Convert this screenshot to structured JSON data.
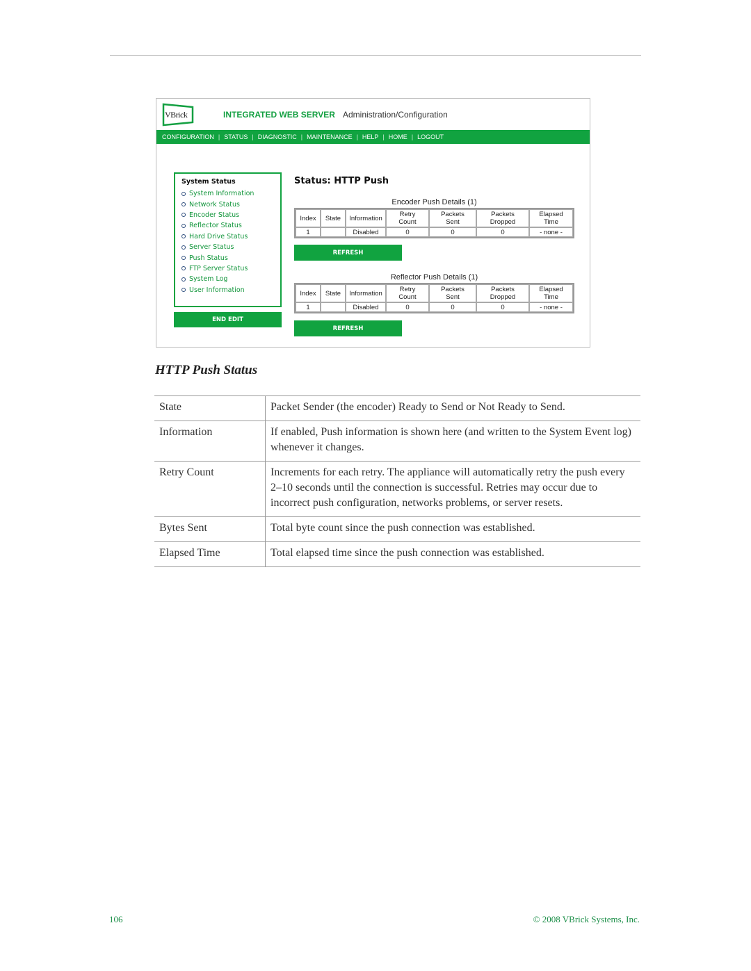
{
  "screenshot": {
    "logo_text": "VBrick",
    "header_title": "INTEGRATED WEB SERVER",
    "header_subtitle": "Administration/Configuration",
    "nav": [
      "CONFIGURATION",
      "STATUS",
      "DIAGNOSTIC",
      "MAINTENANCE",
      "HELP",
      "HOME",
      "LOGOUT"
    ],
    "sidebar": {
      "title": "System Status",
      "items": [
        "System Information",
        "Network Status",
        "Encoder Status",
        "Reflector Status",
        "Hard Drive Status",
        "Server Status",
        "Push Status",
        "FTP Server Status",
        "System Log",
        "User Information"
      ],
      "end_edit_label": "END EDIT"
    },
    "page_title": "Status: HTTP Push",
    "tables": [
      {
        "caption": "Encoder Push Details  (1)",
        "headers": [
          "Index",
          "State",
          "Information",
          "Retry Count",
          "Packets Sent",
          "Packets Dropped",
          "Elapsed Time"
        ],
        "headers_line1": [
          "Index",
          "State",
          "Information",
          "Retry",
          "Packets",
          "Packets",
          "Elapsed"
        ],
        "headers_line2": [
          "",
          "",
          "",
          "Count",
          "Sent",
          "Dropped",
          "Time"
        ],
        "rows": [
          [
            "1",
            "",
            "Disabled",
            "0",
            "0",
            "0",
            "- none -"
          ]
        ],
        "refresh_label": "REFRESH"
      },
      {
        "caption": "Reflector Push Details  (1)",
        "headers": [
          "Index",
          "State",
          "Information",
          "Retry Count",
          "Packets Sent",
          "Packets Dropped",
          "Elapsed Time"
        ],
        "headers_line1": [
          "Index",
          "State",
          "Information",
          "Retry",
          "Packets",
          "Packets",
          "Elapsed"
        ],
        "headers_line2": [
          "",
          "",
          "",
          "Count",
          "Sent",
          "Dropped",
          "Time"
        ],
        "rows": [
          [
            "1",
            "",
            "Disabled",
            "0",
            "0",
            "0",
            "- none -"
          ]
        ],
        "refresh_label": "REFRESH"
      }
    ]
  },
  "section_title": "HTTP Push Status",
  "definitions": [
    {
      "term": "State",
      "description": "Packet Sender (the encoder) Ready to Send or Not Ready to Send."
    },
    {
      "term": "Information",
      "description": "If enabled, Push information is shown here (and written to the System Event log) whenever it changes."
    },
    {
      "term": "Retry Count",
      "description": "Increments for each retry. The appliance will automatically retry the push every 2–10 seconds until the connection is successful. Retries may occur due to incorrect push configuration, networks problems, or server resets."
    },
    {
      "term": "Bytes Sent",
      "description": "Total byte count since the push connection was established."
    },
    {
      "term": "Elapsed Time",
      "description": "Total elapsed time since the push connection was established."
    }
  ],
  "footer": {
    "page_number": "106",
    "copyright": "© 2008 VBrick Systems, Inc."
  },
  "colors": {
    "brand_green": "#11a340",
    "footer_green": "#1d8f49"
  }
}
